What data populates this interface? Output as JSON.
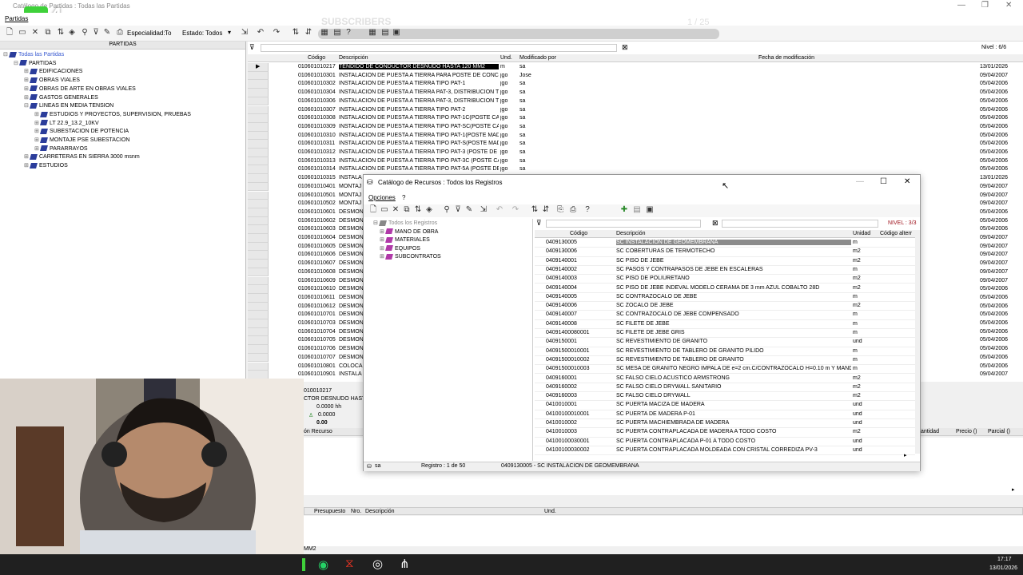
{
  "main_window": {
    "title": "Catálogo de Partidas : Todas las Partidas",
    "menu": [
      "Partidas"
    ],
    "toolbar": {
      "especialidad_label": "Especialidad:",
      "especialidad_value": "To",
      "estado_label": "Estado:",
      "estado_value": "Todos"
    },
    "overlay_text": "SUBSCRIBERS",
    "overlay_counter": "1 / 25",
    "nivel": "Nivel : 6/6"
  },
  "tree": {
    "header": "PARTIDAS",
    "items": [
      {
        "label": "Todas las Partidas",
        "level": 0,
        "expander": "⊟"
      },
      {
        "label": "PARTIDAS",
        "level": 1,
        "expander": "⊟"
      },
      {
        "label": "EDIFICACIONES",
        "level": 2,
        "expander": "⊞"
      },
      {
        "label": "OBRAS VIALES",
        "level": 2,
        "expander": "⊞"
      },
      {
        "label": "OBRAS DE ARTE EN OBRAS VIALES",
        "level": 2,
        "expander": "⊞"
      },
      {
        "label": "GASTOS GENERALES",
        "level": 2,
        "expander": "⊞"
      },
      {
        "label": "LINEAS EN MEDIA TENSION",
        "level": 2,
        "expander": "⊟"
      },
      {
        "label": "ESTUDIOS Y PROYECTOS, SUPERVISION, PRUEBAS",
        "level": 3,
        "expander": "⊞"
      },
      {
        "label": "LT 22.9_13.2_10KV",
        "level": 3,
        "expander": "⊞"
      },
      {
        "label": "SUBESTACION DE POTENCIA",
        "level": 3,
        "expander": "⊞"
      },
      {
        "label": "MONTAJE PSE SUBESTACION",
        "level": 3,
        "expander": "⊞"
      },
      {
        "label": "PARARRAYOS",
        "level": 3,
        "expander": "⊞"
      },
      {
        "label": "CARRETERAS EN SIERRA 3000 msnm",
        "level": 2,
        "expander": "⊞"
      },
      {
        "label": "ESTUDIOS",
        "level": 2,
        "expander": "⊞"
      }
    ]
  },
  "grid": {
    "columns": [
      "Código",
      "Descripción",
      "Und.",
      "Modificado por",
      "Fecha de modificación"
    ],
    "rows": [
      [
        "010601010217",
        "TENDIDO DE CONDUCTOR DESNUDO HASTA 120 MM2",
        "m",
        "sa",
        "13/01/2026"
      ],
      [
        "010601010301",
        "INSTALACION DE PUESTA A TIERRA PARA POSTE DE CONCRE",
        "jgo",
        "Jose",
        "09/04/2007"
      ],
      [
        "010601010302",
        "INSTALACION DE PUESTA A TIERRA TIPO PAT-1",
        "jgo",
        "sa",
        "05/04/2006"
      ],
      [
        "010601010304",
        "INSTALACION DE PUESTA A TIERRA PAT-3, DISTRIBUCION TR",
        "jgo",
        "sa",
        "05/04/2006"
      ],
      [
        "010601010306",
        "INSTALACION DE PUESTA A TIERRA PAT-3, DISTRIBUCION TR",
        "jgo",
        "sa",
        "05/04/2006"
      ],
      [
        "010601010307",
        "INSTALACION DE PUESTA A TIERRA TIPO PAT-2",
        "jgo",
        "sa",
        "05/04/2006"
      ],
      [
        "010601010308",
        "INSTALACION DE PUESTA A TIERRA TIPO PAT-1C(POSTE CAC",
        "jgo",
        "sa",
        "05/04/2006"
      ],
      [
        "010601010309",
        "INSTALACION DE PUESTA A TIERRA TIPO PAT-SC(POSTE CAC",
        "jgo",
        "sa",
        "05/04/2006"
      ],
      [
        "010601010310",
        "INSTALACION DE PUESTA A TIERRA TIPO PAT-1(POSTE MADE",
        "jgo",
        "sa",
        "05/04/2006"
      ],
      [
        "010601010311",
        "INSTALACION DE PUESTA A TIERRA TIPO PAT-S(POSTE MADE",
        "jgo",
        "sa",
        "05/04/2006"
      ],
      [
        "010601010312",
        "INSTALACION DE PUESTA A TIERRA TIPO PAT-3 (POSTE DE M",
        "jgo",
        "sa",
        "05/04/2006"
      ],
      [
        "010601010313",
        "INSTALACION DE PUESTA A TIERRA TIPO PAT-3C (POSTE CAC",
        "jgo",
        "sa",
        "05/04/2006"
      ],
      [
        "010601010314",
        "INSTALACION DE PUESTA A TIERRA TIPO PAT-5A (POSTE DE",
        "jgo",
        "sa",
        "05/04/2006"
      ],
      [
        "010601010315",
        "INSTALA",
        "",
        "",
        "13/01/2026"
      ],
      [
        "010601010401",
        "MONTAJ",
        "",
        "",
        "09/04/2007"
      ],
      [
        "010601010501",
        "MONTAJ",
        "",
        "",
        "09/04/2007"
      ],
      [
        "010601010502",
        "MONTAJ",
        "",
        "",
        "09/04/2007"
      ],
      [
        "010601010601",
        "DESMON",
        "",
        "",
        "05/04/2006"
      ],
      [
        "010601010602",
        "DESMON",
        "",
        "",
        "05/04/2006"
      ],
      [
        "010601010603",
        "DESMON",
        "",
        "",
        "05/04/2006"
      ],
      [
        "010601010604",
        "DESMON",
        "",
        "",
        "09/04/2007"
      ],
      [
        "010601010605",
        "DESMON",
        "",
        "",
        "09/04/2007"
      ],
      [
        "010601010606",
        "DESMON",
        "",
        "",
        "09/04/2007"
      ],
      [
        "010601010607",
        "DESMON",
        "",
        "",
        "09/04/2007"
      ],
      [
        "010601010608",
        "DESMON",
        "",
        "",
        "09/04/2007"
      ],
      [
        "010601010609",
        "DESMON",
        "",
        "",
        "09/04/2007"
      ],
      [
        "010601010610",
        "DESMON",
        "",
        "",
        "05/04/2006"
      ],
      [
        "010601010611",
        "DESMON",
        "",
        "",
        "05/04/2006"
      ],
      [
        "010601010612",
        "DESMON",
        "",
        "",
        "05/04/2006"
      ],
      [
        "010601010701",
        "DESMON",
        "",
        "",
        "05/04/2006"
      ],
      [
        "010601010703",
        "DESMON",
        "",
        "",
        "05/04/2006"
      ],
      [
        "010601010704",
        "DESMON",
        "",
        "",
        "05/04/2006"
      ],
      [
        "010601010705",
        "DESMON",
        "",
        "",
        "05/04/2006"
      ],
      [
        "010601010706",
        "DESMON",
        "",
        "",
        "05/04/2006"
      ],
      [
        "010601010707",
        "DESMON",
        "",
        "",
        "05/04/2006"
      ],
      [
        "010601010801",
        "COLOCA",
        "",
        "",
        "05/04/2006"
      ],
      [
        "010601010901",
        "INSTALA",
        "",
        "",
        "09/04/2007"
      ]
    ]
  },
  "detail": {
    "code": "010010217",
    "desc": "CTOR DESNUDO HAST",
    "hh": "0.0000 hh",
    "qty": "0.0000",
    "val": "0.00",
    "recurso": "ón Recurso",
    "cantidad": "antidad",
    "precio": "Precio ()",
    "parcial": "Parcial ()",
    "footer_cols": [
      "Presupuesto",
      "Nro.",
      "Descripción",
      "Und."
    ],
    "footer_text": "MM2"
  },
  "dialog": {
    "title": "Catálogo de Recursos : Todos los Registros",
    "menu": [
      "Opciones",
      "?"
    ],
    "nivel": "NIVEL : 3/3",
    "tree": [
      {
        "label": "Todos los Registros",
        "level": 0,
        "expander": "⊟"
      },
      {
        "label": "MANO DE OBRA",
        "level": 1,
        "expander": "⊞"
      },
      {
        "label": "MATERIALES",
        "level": 1,
        "expander": "⊞"
      },
      {
        "label": "EQUIPOS",
        "level": 1,
        "expander": "⊞"
      },
      {
        "label": "SUBCONTRATOS",
        "level": 1,
        "expander": "⊞"
      }
    ],
    "columns": [
      "Código",
      "Descripción",
      "Unidad",
      "Código alterr"
    ],
    "rows": [
      [
        "0409130005",
        "SC INSTALACION DE GEOMEMBRANA",
        "m"
      ],
      [
        "0409130006",
        "SC COBERTURAS DE TERMOTECHO",
        "m2"
      ],
      [
        "0409140001",
        "SC PISO DE JEBE",
        "m2"
      ],
      [
        "0409140002",
        "SC PASOS Y CONTRAPASOS DE JEBE EN ESCALERAS",
        "m"
      ],
      [
        "0409140003",
        "SC PISO DE POLIURETANO",
        "m2"
      ],
      [
        "0409140004",
        "SC PISO DE JEBE INDEVAL MODELO CERAMA DE 3 mm AZUL COBALTO 28D",
        "m2"
      ],
      [
        "0409140005",
        "SC CONTRAZOCALO DE JEBE",
        "m"
      ],
      [
        "0409140006",
        "SC ZOCALO DE JEBE",
        "m2"
      ],
      [
        "0409140007",
        "SC CONTRAZOCALO DE JEBE COMPENSADO",
        "m"
      ],
      [
        "0409140008",
        "SC FILETE DE JEBE",
        "m"
      ],
      [
        "04091400080001",
        "SC FILETE DE JEBE GRIS",
        "m"
      ],
      [
        "0409150001",
        "SC REVESTIMIENTO DE GRANITO",
        "und"
      ],
      [
        "04091500010001",
        "SC REVESTIMIENTO DE TABLERO DE GRANITO PILIDO",
        "m"
      ],
      [
        "04091500010002",
        "SC REVESTIMIENTO DE TABLERO DE GRANITO",
        "m"
      ],
      [
        "04091500010003",
        "SC MESA DE GRANITO NEGRO IMPALA DE e=2 cm.C/CONTRAZOCALO H=0.10 m Y MANDI",
        "m"
      ],
      [
        "0409160001",
        "SC FALSO CIELO ACUSTICO ARMSTRONG",
        "m2"
      ],
      [
        "0409160002",
        "SC FALSO CIELO DRYWALL SANITARIO",
        "m2"
      ],
      [
        "0409160003",
        "SC FALSO CIELO DRYWALL",
        "m2"
      ],
      [
        "0410010001",
        "SC PUERTA MACIZA DE MADERA",
        "und"
      ],
      [
        "04100100010001",
        "SC PUERTA DE MADERA P-01",
        "und"
      ],
      [
        "0410010002",
        "SC PUERTA MACHIEMBRADA DE MADERA",
        "und"
      ],
      [
        "0410010003",
        "SC PUERTA CONTRAPLACADA DE MADERA A TODO COSTO",
        "m2"
      ],
      [
        "04100100030001",
        "SC PUERTA CONTRAPLACADA P-01 A TODO COSTO",
        "und"
      ],
      [
        "04100100030002",
        "SC PUERTA CONTRAPLACADA MOLDEADA CON CRISTAL CORREDIZA PV-3",
        "und"
      ]
    ],
    "status_user": "sa",
    "status_registro": "Registro : 1 de 50",
    "status_selected": "0409130005 - SC INSTALACION DE GEOMEMBRANA"
  },
  "taskbar": {
    "time": "17:17",
    "date": "13/01/2026"
  },
  "colors": {
    "tree_icon": "#2b3d9b",
    "selection": "#000000",
    "dialog_selection": "#8b8b8b",
    "nivel_text": "#a0141e",
    "taskbar": "#202020",
    "logo_green": "#3fd13a"
  }
}
